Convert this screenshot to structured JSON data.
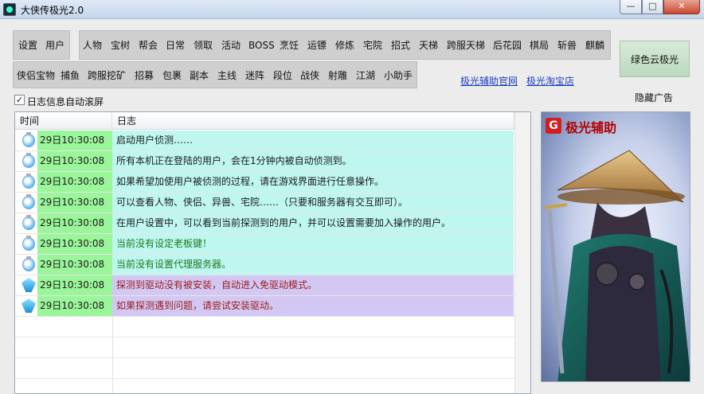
{
  "window": {
    "title": "大侠传极光2.0",
    "minimize": "—",
    "maximize": "□",
    "close": "✕"
  },
  "menu_row1_left": [
    "设置",
    "用户"
  ],
  "menu_row1": [
    "人物",
    "宝树",
    "帮会",
    "日常",
    "领取",
    "活动",
    "BOSS",
    "烹饪",
    "运镖",
    "修炼",
    "宅院",
    "招式",
    "天梯",
    "跨服天梯",
    "后花园",
    "棋局",
    "斩兽",
    "麒麟"
  ],
  "menu_row2": [
    "侠侣宝物",
    "捕鱼",
    "跨服挖矿",
    "招募",
    "包裹",
    "副本",
    "主线",
    "迷阵",
    "段位",
    "战侠",
    "射雕",
    "江湖",
    "小助手"
  ],
  "green_button": "绿色云极光",
  "links": {
    "official": "极光辅助官网",
    "taobao": "极光淘宝店"
  },
  "hide_ad": "隐藏广告",
  "autoscroll": {
    "checked": true,
    "mark": "✓",
    "label": "日志信息自动滚屏"
  },
  "log_table": {
    "headers": {
      "time": "时间",
      "log": "日志"
    },
    "rows": [
      {
        "type": "info",
        "icon": "info-bulb-icon",
        "time": "29日10:30:08",
        "message": "启动用户侦测……",
        "color": "#1a1a1a"
      },
      {
        "type": "info",
        "icon": "info-bulb-icon",
        "time": "29日10:30:08",
        "message": "所有本机正在登陆的用户，会在1分钟内被自动侦测到。",
        "color": "#1a1a1a"
      },
      {
        "type": "info",
        "icon": "info-bulb-icon",
        "time": "29日10:30:08",
        "message": "如果希望加使用户被侦测的过程，请在游戏界面进行任意操作。",
        "color": "#1a1a1a"
      },
      {
        "type": "info",
        "icon": "info-bulb-icon",
        "time": "29日10:30:08",
        "message": "可以查看人物、侠侣、异兽、宅院……（只要和服务器有交互即可）。",
        "color": "#1a1a1a"
      },
      {
        "type": "info",
        "icon": "info-bulb-icon",
        "time": "29日10:30:08",
        "message": "在用户设置中，可以看到当前探测到的用户，并可以设置需要加入操作的用户。",
        "color": "#1a1a1a"
      },
      {
        "type": "info",
        "icon": "info-bulb-icon",
        "time": "29日10:30:08",
        "message": "当前没有设定老板键！",
        "color": "#1a7a1a"
      },
      {
        "type": "info",
        "icon": "info-bulb-icon",
        "time": "29日10:30:08",
        "message": "当前没有设置代理服务器。",
        "color": "#1a7a1a"
      },
      {
        "type": "warn",
        "icon": "diamond-warning-icon",
        "time": "29日10:30:08",
        "message": "探测到驱动没有被安装，自动进入免驱动模式。",
        "color": "#9b1c1c"
      },
      {
        "type": "warn",
        "icon": "diamond-warning-icon",
        "time": "29日10:30:08",
        "message": "如果探测遇到问题，请尝试安装驱动。",
        "color": "#9b1c1c"
      }
    ]
  },
  "ad": {
    "badge": "G",
    "title": "极光辅助"
  }
}
